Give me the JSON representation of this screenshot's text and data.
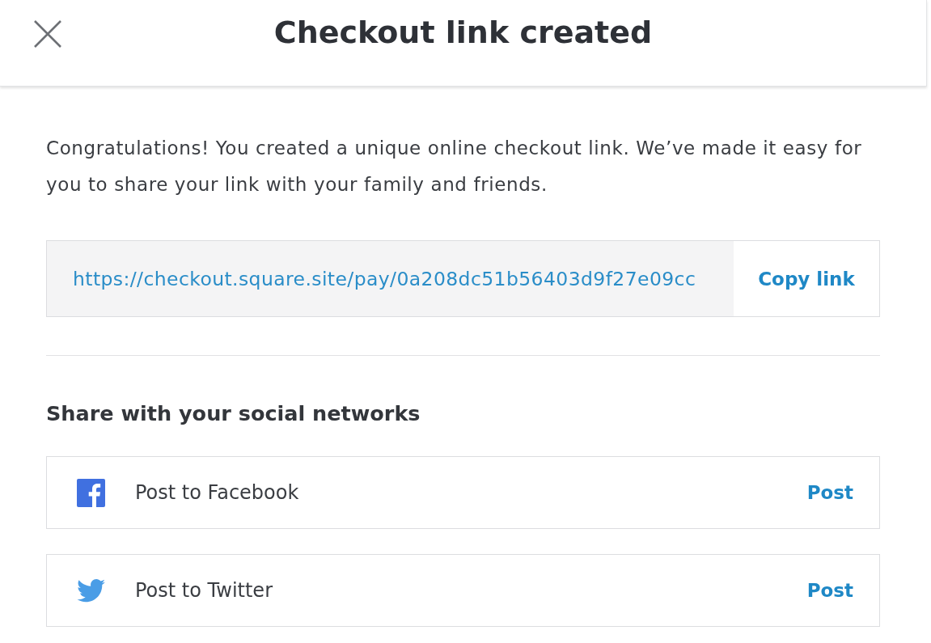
{
  "header": {
    "title": "Checkout link created"
  },
  "message": "Congratulations! You created a unique online checkout link. We’ve made it easy for you to share your link with your family and friends.",
  "link_box": {
    "value": "https://checkout.square.site/pay/0a208dc51b56403d9f27e09cc",
    "button": "Copy link"
  },
  "share": {
    "heading": "Share with your social networks",
    "networks": [
      {
        "kind": "facebook",
        "label": "Post to Facebook",
        "action": "Post"
      },
      {
        "kind": "twitter",
        "label": "Post to Twitter",
        "action": "Post"
      }
    ]
  }
}
